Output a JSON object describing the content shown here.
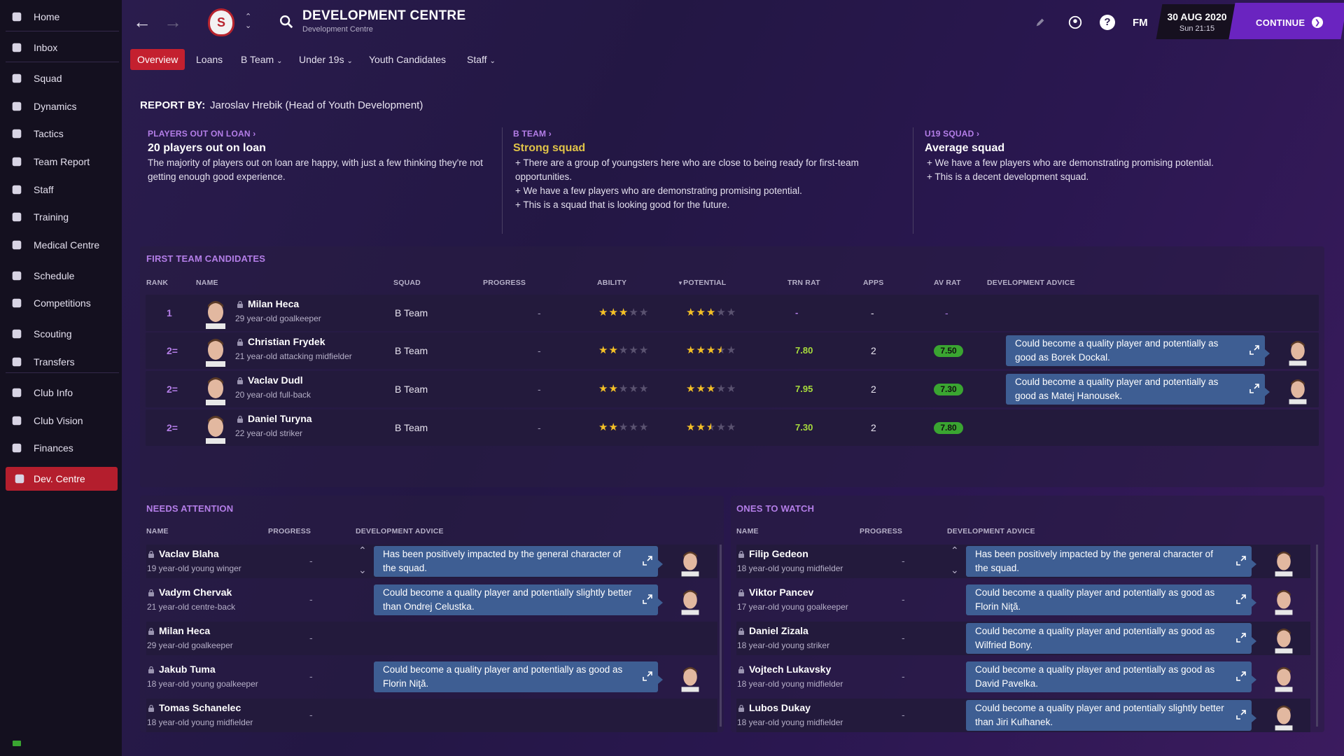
{
  "sidebar": {
    "items": [
      {
        "label": "Home",
        "icon": "home-icon"
      },
      {
        "label": "Inbox",
        "icon": "inbox-icon"
      },
      {
        "label": "Squad",
        "icon": "shirt-icon"
      },
      {
        "label": "Dynamics",
        "icon": "dynamics-icon"
      },
      {
        "label": "Tactics",
        "icon": "tactics-icon"
      },
      {
        "label": "Team Report",
        "icon": "report-icon"
      },
      {
        "label": "Staff",
        "icon": "staff-icon"
      },
      {
        "label": "Training",
        "icon": "training-icon"
      },
      {
        "label": "Medical Centre",
        "icon": "medical-icon"
      },
      {
        "label": "Schedule",
        "icon": "calendar-icon"
      },
      {
        "label": "Competitions",
        "icon": "trophy-icon"
      },
      {
        "label": "Scouting",
        "icon": "scouting-icon"
      },
      {
        "label": "Transfers",
        "icon": "transfers-icon"
      },
      {
        "label": "Club Info",
        "icon": "shield-icon"
      },
      {
        "label": "Club Vision",
        "icon": "vision-icon"
      },
      {
        "label": "Finances",
        "icon": "finances-icon"
      },
      {
        "label": "Dev. Centre",
        "icon": "dev-centre-icon"
      }
    ]
  },
  "header": {
    "title": "DEVELOPMENT CENTRE",
    "subtitle": "Development Centre",
    "fm": "FM",
    "date": "30 AUG 2020",
    "time": "Sun 21:15",
    "continue": "CONTINUE",
    "crest": "S"
  },
  "tabs": [
    {
      "label": "Overview"
    },
    {
      "label": "Loans"
    },
    {
      "label": "B Team"
    },
    {
      "label": "Under 19s"
    },
    {
      "label": "Youth Candidates"
    },
    {
      "label": "Staff"
    }
  ],
  "report": {
    "by_label": "REPORT BY:",
    "by_name": "Jaroslav Hrebik (Head of Youth Development)",
    "loan": {
      "head": "PLAYERS OUT ON LOAN",
      "sub": "20 players out on loan",
      "text": "The majority of players out on loan are happy, with just a few thinking they're not getting enough good experience."
    },
    "bteam": {
      "head": "B TEAM",
      "sub": "Strong squad",
      "lines": [
        "+ There are a group of youngsters here who are close to being ready for first-team opportunities.",
        "+ We have a few players who are demonstrating promising potential.",
        "+ This is a squad that is looking good for the future."
      ]
    },
    "u19": {
      "head": "U19 SQUAD",
      "sub": "Average squad",
      "lines": [
        "+ We have a few players who are demonstrating promising potential.",
        "+ This is a decent development squad."
      ]
    }
  },
  "ftc": {
    "title": "FIRST TEAM CANDIDATES",
    "headers": {
      "rank": "RANK",
      "name": "NAME",
      "squad": "SQUAD",
      "progress": "PROGRESS",
      "ability": "ABILITY",
      "potential": "POTENTIAL",
      "trn": "TRN RAT",
      "apps": "APPS",
      "av": "AV RAT",
      "advice": "DEVELOPMENT ADVICE"
    },
    "rows": [
      {
        "rank": "1",
        "name": "Milan Heca",
        "desc": "29 year-old goalkeeper",
        "squad": "B Team",
        "progress": "-",
        "ability": 3,
        "potential": 3,
        "trn": "-",
        "apps": "-",
        "av": "-",
        "advice": ""
      },
      {
        "rank": "2=",
        "name": "Christian Frydek",
        "desc": "21 year-old attacking midfielder",
        "squad": "B Team",
        "progress": "-",
        "ability": 2,
        "potential": 3.5,
        "trn": "7.80",
        "apps": "2",
        "av": "7.50",
        "advice": "Could become a quality player and potentially as good as Borek Dockal."
      },
      {
        "rank": "2=",
        "name": "Vaclav Dudl",
        "desc": "20 year-old full-back",
        "squad": "B Team",
        "progress": "-",
        "ability": 2,
        "potential": 3,
        "trn": "7.95",
        "apps": "2",
        "av": "7.30",
        "advice": "Could become a quality player and potentially as good as Matej Hanousek."
      },
      {
        "rank": "2=",
        "name": "Daniel Turyna",
        "desc": "22 year-old striker",
        "squad": "B Team",
        "progress": "-",
        "ability": 2,
        "potential": 2.5,
        "trn": "7.30",
        "apps": "2",
        "av": "7.80",
        "advice": ""
      }
    ]
  },
  "needs": {
    "title": "NEEDS ATTENTION",
    "headers": {
      "name": "NAME",
      "progress": "PROGRESS",
      "advice": "DEVELOPMENT ADVICE"
    },
    "rows": [
      {
        "name": "Vaclav Blaha",
        "desc": "19 year-old young winger",
        "progress": "-",
        "advice": "Has been positively impacted by the general character of the squad."
      },
      {
        "name": "Vadym Chervak",
        "desc": "21 year-old centre-back",
        "progress": "-",
        "advice": "Could become a quality player and potentially slightly better than Ondrej Celustka."
      },
      {
        "name": "Milan Heca",
        "desc": "29 year-old goalkeeper",
        "progress": "-",
        "advice": ""
      },
      {
        "name": "Jakub Tuma",
        "desc": "18 year-old young goalkeeper",
        "progress": "-",
        "advice": "Could become a quality player and potentially as good as Florin Niţă."
      },
      {
        "name": "Tomas Schanelec",
        "desc": "18 year-old young midfielder",
        "progress": "-",
        "advice": ""
      }
    ]
  },
  "watch": {
    "title": "ONES TO WATCH",
    "headers": {
      "name": "NAME",
      "progress": "PROGRESS",
      "advice": "DEVELOPMENT ADVICE"
    },
    "rows": [
      {
        "name": "Filip Gedeon",
        "desc": "18 year-old young midfielder",
        "progress": "-",
        "advice": "Has been positively impacted by the general character of the squad."
      },
      {
        "name": "Viktor Pancev",
        "desc": "17 year-old young goalkeeper",
        "progress": "-",
        "advice": "Could become a quality player and potentially as good as Florin Niţă."
      },
      {
        "name": "Daniel Zizala",
        "desc": "18 year-old young striker",
        "progress": "-",
        "advice": "Could become a quality player and potentially as good as Wilfried Bony."
      },
      {
        "name": "Vojtech Lukavsky",
        "desc": "18 year-old young midfielder",
        "progress": "-",
        "advice": "Could become a quality player and potentially as good as David Pavelka."
      },
      {
        "name": "Lubos Dukay",
        "desc": "18 year-old young midfielder",
        "progress": "-",
        "advice": "Could become a quality player and potentially slightly better than Jiri Kulhanek."
      }
    ]
  },
  "colors": {
    "accent": "#6a24c0",
    "active": "#c4202f",
    "purple_head": "#b47ee8",
    "advice_bg": "#3e5e93",
    "star": "#f4c026",
    "rating_green": "#3aa531"
  }
}
